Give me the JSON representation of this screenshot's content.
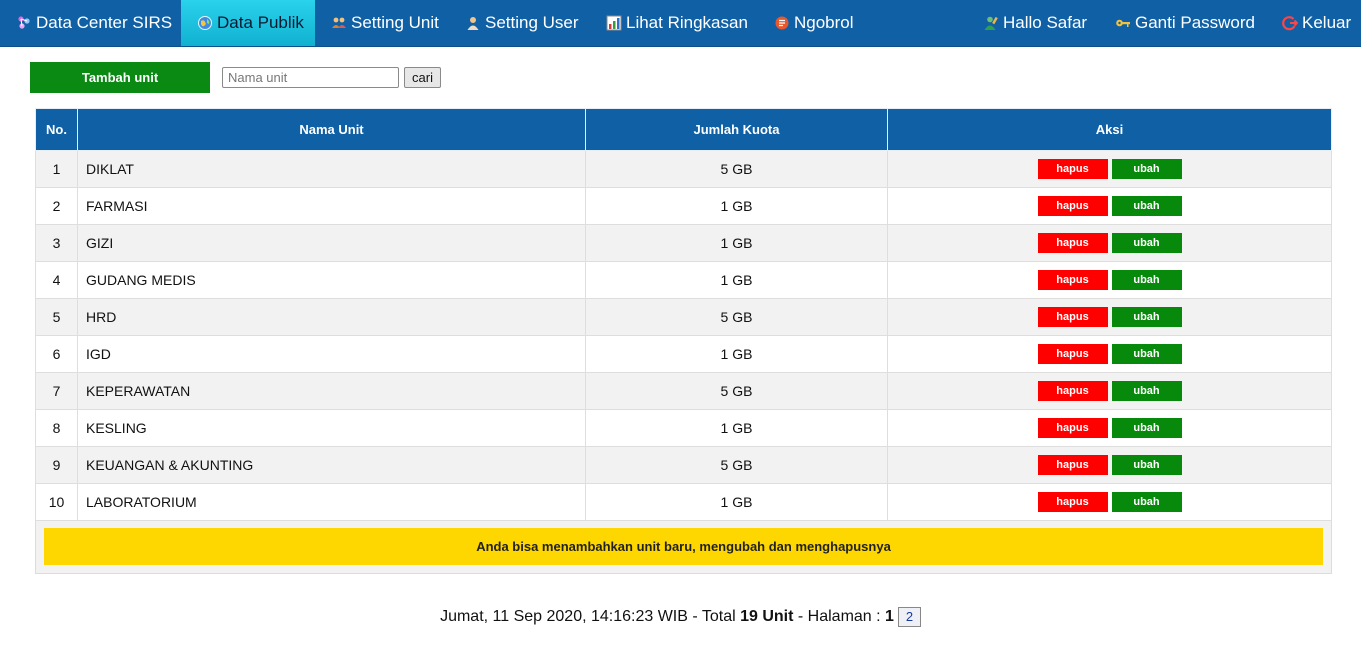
{
  "nav": {
    "brand": {
      "label": "Data Center SIRS",
      "icon": "network-icon"
    },
    "items": [
      {
        "label": "Data Publik",
        "icon": "globe-icon",
        "active": true
      },
      {
        "label": "Setting Unit",
        "icon": "group-icon"
      },
      {
        "label": "Setting User",
        "icon": "user-icon"
      },
      {
        "label": "Lihat Ringkasan",
        "icon": "chart-icon"
      },
      {
        "label": "Ngobrol",
        "icon": "chat-icon"
      }
    ],
    "right": [
      {
        "label": "Hallo Safar",
        "icon": "user-edit-icon"
      },
      {
        "label": "Ganti Password",
        "icon": "key-icon"
      },
      {
        "label": "Keluar",
        "icon": "logout-icon"
      }
    ]
  },
  "toolbar": {
    "add_label": "Tambah unit",
    "search_placeholder": "Nama unit",
    "search_value": "",
    "search_button": "cari"
  },
  "table": {
    "headers": {
      "no": "No.",
      "name": "Nama Unit",
      "quota": "Jumlah Kuota",
      "aksi": "Aksi"
    },
    "action_delete": "hapus",
    "action_edit": "ubah",
    "rows": [
      {
        "no": "1",
        "name": "DIKLAT",
        "quota": "5 GB"
      },
      {
        "no": "2",
        "name": "FARMASI",
        "quota": "1 GB"
      },
      {
        "no": "3",
        "name": "GIZI",
        "quota": "1 GB"
      },
      {
        "no": "4",
        "name": "GUDANG MEDIS",
        "quota": "1 GB"
      },
      {
        "no": "5",
        "name": "HRD",
        "quota": "5 GB"
      },
      {
        "no": "6",
        "name": "IGD",
        "quota": "1 GB"
      },
      {
        "no": "7",
        "name": "KEPERAWATAN",
        "quota": "5 GB"
      },
      {
        "no": "8",
        "name": "KESLING",
        "quota": "1 GB"
      },
      {
        "no": "9",
        "name": "KEUANGAN & AKUNTING",
        "quota": "5 GB"
      },
      {
        "no": "10",
        "name": "LABORATORIUM",
        "quota": "1 GB"
      }
    ],
    "notice": "Anda bisa menambahkan unit baru, mengubah dan menghapusnya"
  },
  "footer": {
    "datetime": "Jumat, 11 Sep 2020, 14:16:23 WIB",
    "total_prefix": " - Total ",
    "total_value": "19 Unit",
    "page_prefix": " - Halaman : ",
    "current_page": "1",
    "other_page": "2"
  },
  "colors": {
    "nav_bg": "#1060a6",
    "nav_active": "#19c0dc",
    "add_button": "#0a8a12",
    "delete_button": "#ff0000",
    "edit_button": "#078a0c",
    "notice_bg": "#ffd700"
  }
}
